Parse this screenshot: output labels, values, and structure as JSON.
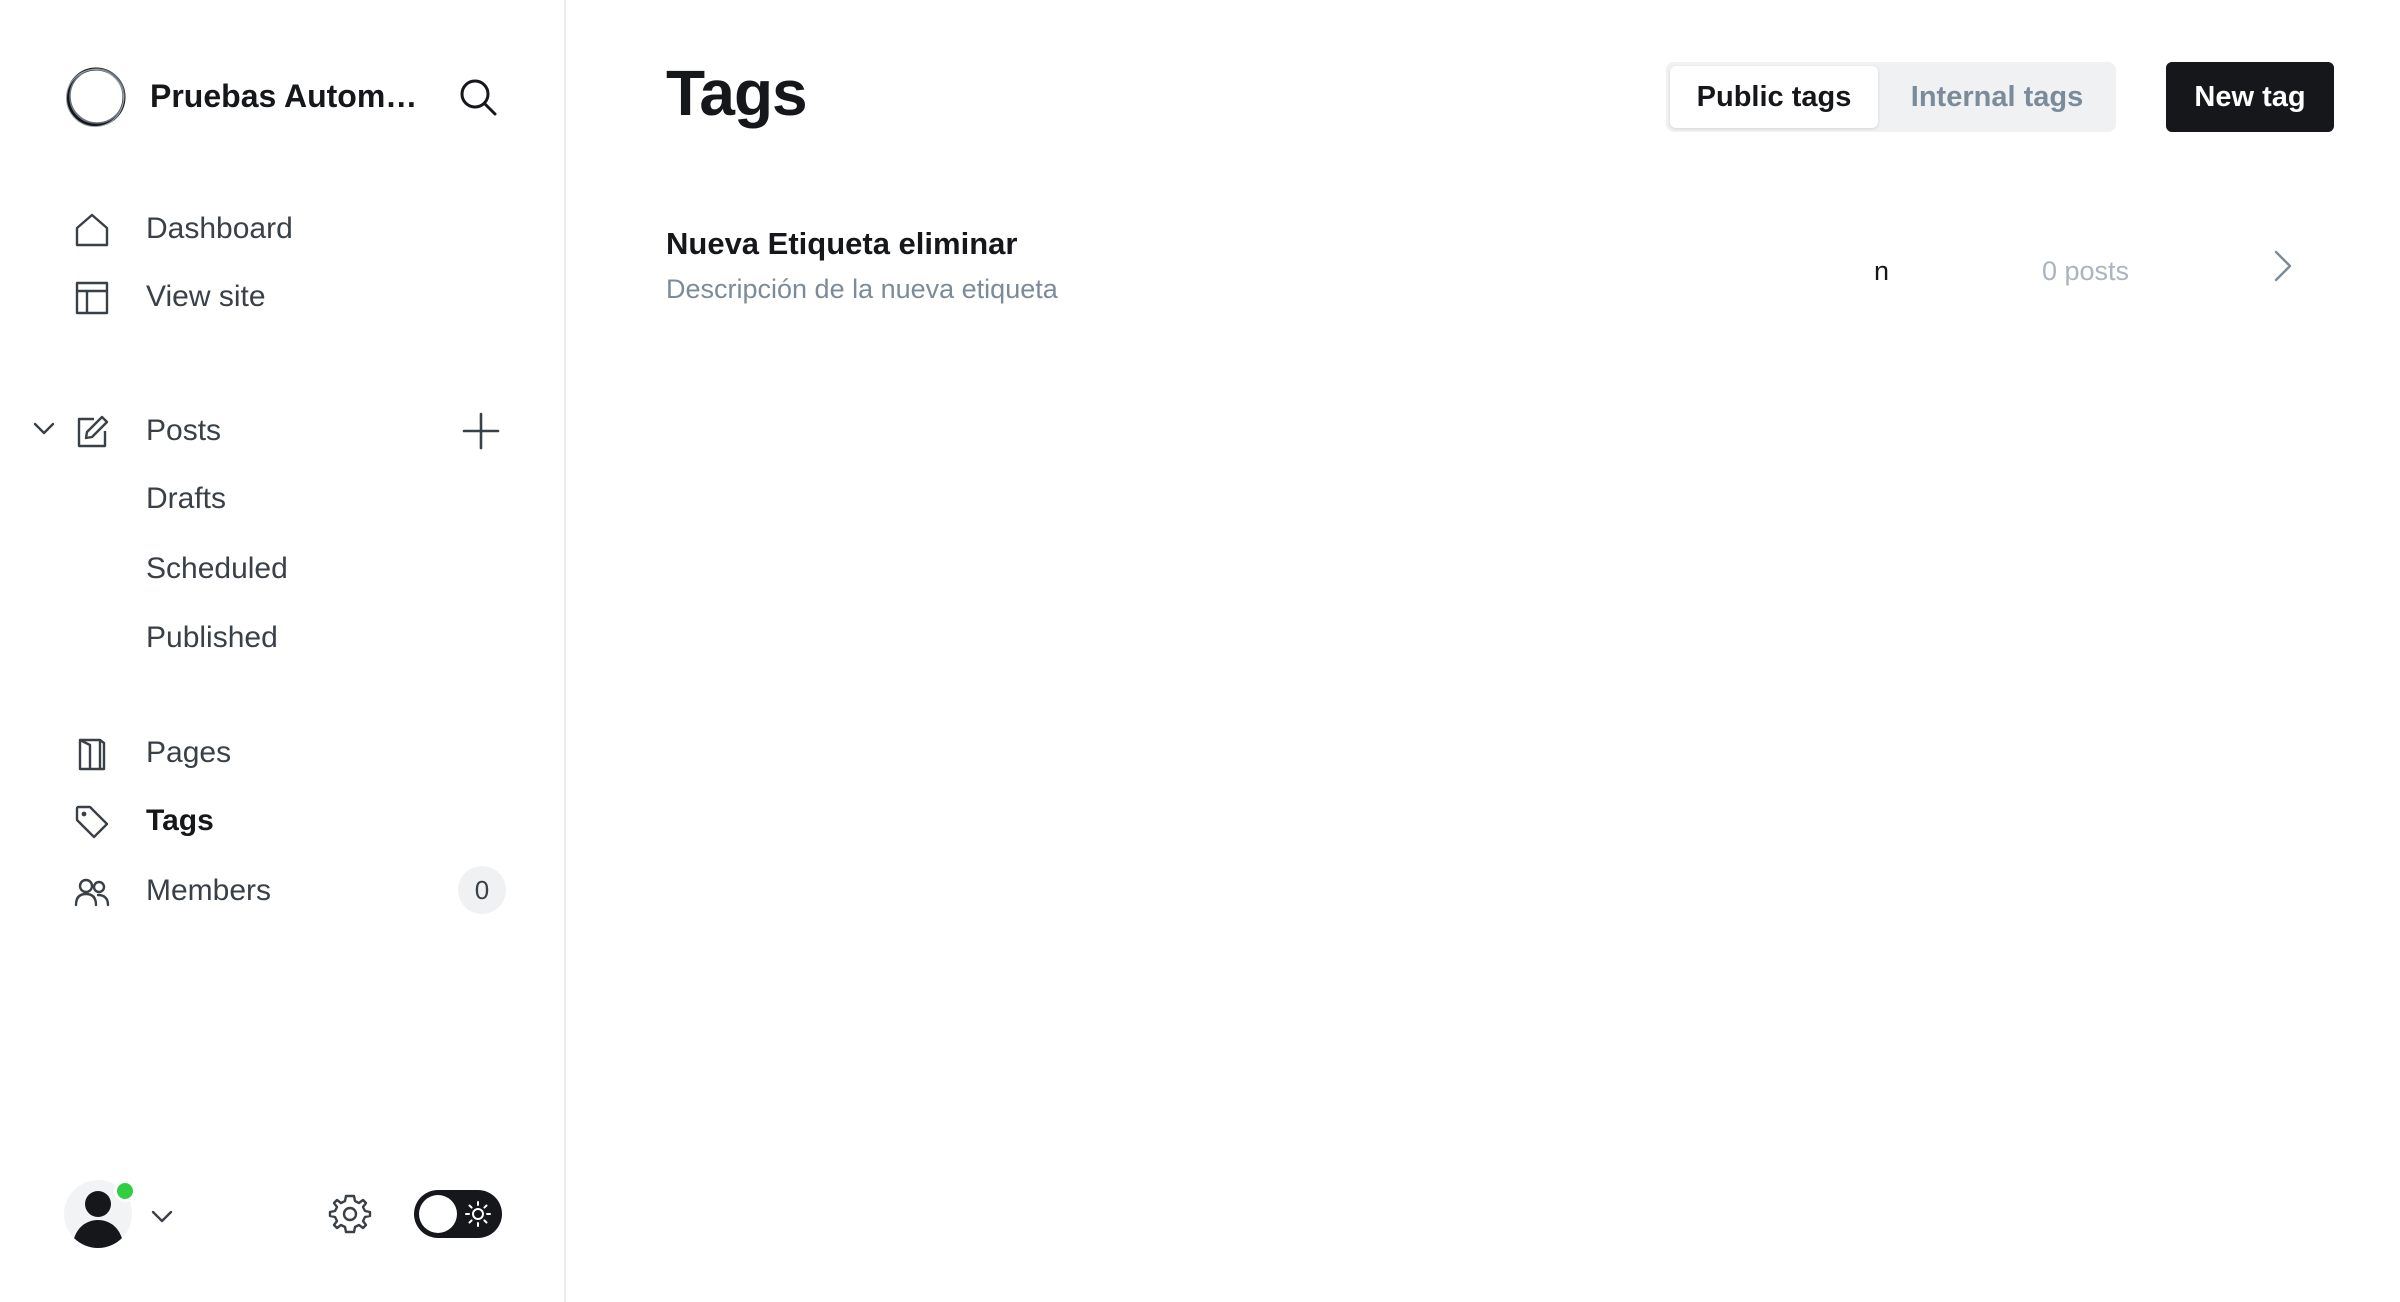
{
  "site": {
    "title": "Pruebas Automa..."
  },
  "sidebar": {
    "top_items": [
      {
        "label": "Dashboard",
        "icon": "home-icon"
      },
      {
        "label": "View site",
        "icon": "layout-icon"
      }
    ],
    "posts": {
      "label": "Posts",
      "icon": "edit-icon",
      "sub_items": [
        {
          "label": "Drafts"
        },
        {
          "label": "Scheduled"
        },
        {
          "label": "Published"
        }
      ]
    },
    "items": [
      {
        "label": "Pages",
        "icon": "page-icon"
      },
      {
        "label": "Tags",
        "icon": "tag-icon",
        "active": true
      },
      {
        "label": "Members",
        "icon": "members-icon",
        "count": "0"
      }
    ]
  },
  "main": {
    "title": "Tags",
    "tabs": [
      {
        "label": "Public tags",
        "selected": true
      },
      {
        "label": "Internal tags",
        "selected": false
      }
    ],
    "new_button_label": "New tag",
    "tags": [
      {
        "name": "Nueva Etiqueta eliminar",
        "description": "Descripción de la nueva etiqueta",
        "slug": "n",
        "post_count": "0 posts"
      }
    ]
  },
  "colors": {
    "accent_dark": "#15171a",
    "online": "#30cf43",
    "muted": "#7c8b9a",
    "border": "#ebeef0"
  }
}
